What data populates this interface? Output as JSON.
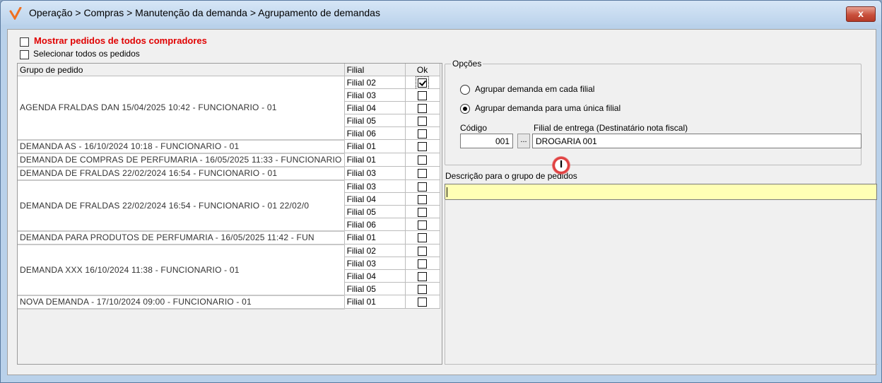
{
  "window": {
    "title": "Operação > Compras > Manutenção da demanda > Agrupamento de demandas",
    "close_label": "x"
  },
  "options_top": {
    "show_all_buyers": "Mostrar pedidos de todos compradores",
    "select_all_orders": "Selecionar todos os pedidos"
  },
  "grid": {
    "headers": {
      "group": "Grupo de pedido",
      "branch": "Filial",
      "ok": "Ok"
    },
    "groups": [
      "AGENDA FRALDAS DAN 15/04/2025 10:42 - FUNCIONARIO - 01",
      "DEMANDA AS - 16/10/2024 10:18 - FUNCIONARIO - 01",
      "DEMANDA DE COMPRAS DE PERFUMARIA - 16/05/2025 11:33 - FUNCIONARIO",
      "DEMANDA DE FRALDAS 22/02/2024 16:54 - FUNCIONARIO - 01",
      "DEMANDA DE FRALDAS 22/02/2024 16:54 - FUNCIONARIO - 01 22/02/0",
      "DEMANDA PARA PRODUTOS DE PERFUMARIA - 16/05/2025 11:42 - FUN",
      "DEMANDA XXX 16/10/2024 11:38 - FUNCIONARIO - 01",
      "NOVA DEMANDA - 17/10/2024 09:00 - FUNCIONARIO - 01"
    ],
    "rows": [
      {
        "branch": "Filial 02",
        "ok": true
      },
      {
        "branch": "Filial 03",
        "ok": false
      },
      {
        "branch": "Filial 04",
        "ok": false
      },
      {
        "branch": "Filial 05",
        "ok": false
      },
      {
        "branch": "Filial 06",
        "ok": false
      },
      {
        "branch": "Filial 01",
        "ok": false
      },
      {
        "branch": "Filial 01",
        "ok": false
      },
      {
        "branch": "Filial 03",
        "ok": false
      },
      {
        "branch": "Filial 03",
        "ok": false
      },
      {
        "branch": "Filial 04",
        "ok": false
      },
      {
        "branch": "Filial 05",
        "ok": false
      },
      {
        "branch": "Filial 06",
        "ok": false
      },
      {
        "branch": "Filial 01",
        "ok": false
      },
      {
        "branch": "Filial 02",
        "ok": false
      },
      {
        "branch": "Filial 03",
        "ok": false
      },
      {
        "branch": "Filial 04",
        "ok": false
      },
      {
        "branch": "Filial 05",
        "ok": false
      },
      {
        "branch": "Filial 01",
        "ok": false
      }
    ]
  },
  "options": {
    "legend": "Opções",
    "radio_each_branch": "Agrupar demanda em cada filial",
    "radio_single_branch": "Agrupar demanda para uma única filial",
    "selected_radio": "single_branch",
    "code_label": "Código",
    "code_value": "001",
    "lookup_button": "...",
    "delivery_label": "Filial de entrega (Destinatário nota fiscal)",
    "delivery_value": "DROGARIA 001"
  },
  "description": {
    "label": "Descrição para o grupo de pedidos",
    "value": ""
  },
  "colors": {
    "accent_red": "#e00000",
    "input_highlight": "#ffffb5",
    "app_icon": "#f07020"
  }
}
